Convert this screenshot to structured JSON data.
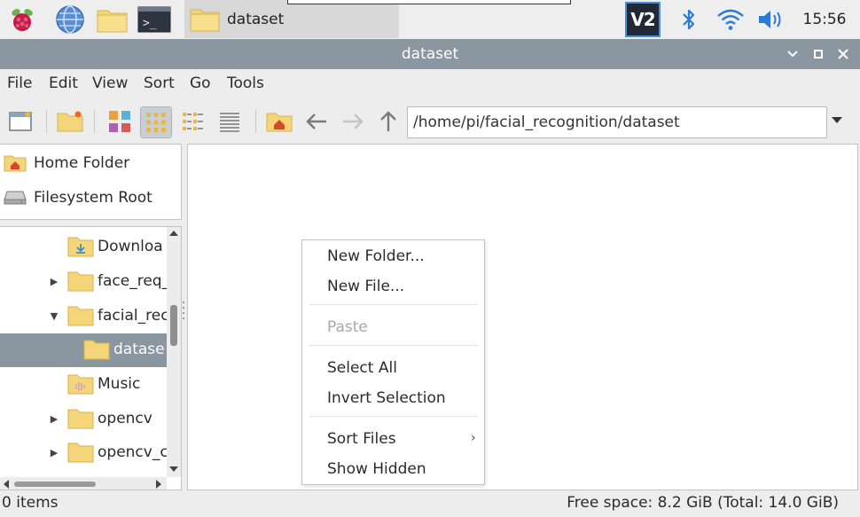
{
  "taskbar": {
    "task_label": "dataset",
    "clock": "15:56",
    "icons": [
      "raspberry-pi-icon",
      "web-browser-icon",
      "file-manager-icon",
      "terminal-icon",
      "vnc-icon",
      "bluetooth-icon",
      "wifi-icon",
      "volume-icon"
    ],
    "vnc_text": "V2"
  },
  "window": {
    "title": "dataset"
  },
  "menubar": {
    "items": [
      "File",
      "Edit",
      "View",
      "Sort",
      "Go",
      "Tools"
    ]
  },
  "toolbar": {
    "path": "/home/pi/facial_recognition/dataset"
  },
  "places": [
    {
      "label": "Home Folder"
    },
    {
      "label": "Filesystem Root"
    }
  ],
  "tree": [
    {
      "label": "Downloa",
      "expander": ""
    },
    {
      "label": "face_req_",
      "expander": "▶"
    },
    {
      "label": "facial_rec",
      "expander": "▼"
    },
    {
      "label": "datase",
      "expander": ""
    },
    {
      "label": "Music",
      "expander": ""
    },
    {
      "label": "opencv",
      "expander": "▶"
    },
    {
      "label": "opencv_c",
      "expander": "▶"
    }
  ],
  "context_menu": {
    "items": [
      {
        "label": "New Folder...",
        "enabled": true
      },
      {
        "label": "New File...",
        "enabled": true
      },
      {
        "label": "Paste",
        "enabled": false
      },
      {
        "label": "Select All",
        "enabled": true
      },
      {
        "label": "Invert Selection",
        "enabled": true
      },
      {
        "label": "Sort Files",
        "enabled": true,
        "submenu": true
      },
      {
        "label": "Show Hidden",
        "enabled": true
      }
    ]
  },
  "status": {
    "items_count": "0 items",
    "free_space": "Free space: 8.2 GiB (Total: 14.0 GiB)"
  },
  "colors": {
    "titlebar": "#8a96a0",
    "selection": "#8a96a0",
    "folder": "#f5d57a"
  }
}
